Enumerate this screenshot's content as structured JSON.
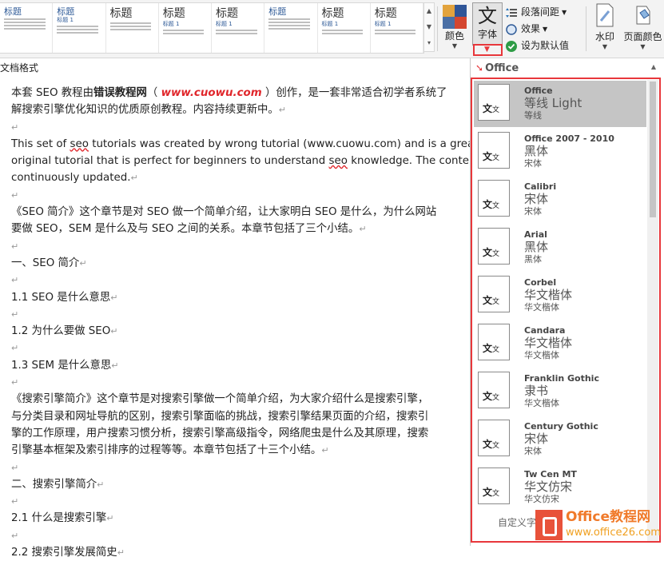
{
  "ribbon": {
    "styles_gallery": [
      {
        "heading": "标题",
        "sub": ""
      },
      {
        "heading": "标题",
        "sub": "标题 1"
      },
      {
        "heading": "标题",
        "sub": ""
      },
      {
        "heading": "标题",
        "sub": "标题 1"
      },
      {
        "heading": "标题",
        "sub": "标题 1"
      },
      {
        "heading": "标题",
        "sub": ""
      },
      {
        "heading": "标题",
        "sub": "标题 1"
      },
      {
        "heading": "标题",
        "sub": "标题 1"
      }
    ],
    "colors_label": "颜色",
    "fonts_label": "字体",
    "fonts_glyph": "文",
    "paragraph_spacing_label": "段落间距",
    "effects_label": "效果",
    "set_default_label": "设为默认值",
    "watermark_label": "水印",
    "page_color_label": "页面颜色",
    "swatch_colors": [
      "#e2a33d",
      "#2f5597",
      "#4a6fa5",
      "#d4462f"
    ]
  },
  "document_formatting_label": "文档格式",
  "document": {
    "p1_pre": "本套 SEO 教程由",
    "p1_bold": "错误教程网",
    "p1_url": "www.cuowu.com",
    "p1_post": "）创作，是一套非常适合初学者系统了",
    "p2": "解搜索引擎优化知识的优质原创教程。内容持续更新中。",
    "en1": "This set of seo tutorials was created by wrong tutorial (www.cuowu.com) and is a great",
    "en2": "original tutorial that is perfect for beginners to understand seo knowledge. The content is",
    "en3": "continuously updated.",
    "s1a": "《SEO 简介》这个章节是对 SEO 做一个简单介绍，让大家明白 SEO 是什么，为什么网站",
    "s1b": "要做 SEO，SEM 是什么及与 SEO 之间的关系。本章节包括了三个小结。",
    "h1": "一、SEO 简介",
    "h11": "1.1 SEO 是什么意思",
    "h12": "1.2  为什么要做 SEO",
    "h13": "1.3 SEM 是什么意思",
    "s2a": "《搜索引擎简介》这个章节是对搜索引擎做一个简单介绍，为大家介绍什么是搜索引擎，",
    "s2b": "与分类目录和网址导航的区别，搜索引擎面临的挑战，搜索引擎结果页面的介绍，搜索引",
    "s2c": "擎的工作原理，用户搜索习惯分析，搜索引擎高级指令，网络爬虫是什么及其原理，搜索",
    "s2d": "引擎基本框架及索引排序的过程等等。本章节包括了十三个小结。",
    "h2": "二、搜索引擎简介",
    "h21": "2.1 什么是搜索引擎",
    "h22": "2.2 搜索引擎发展简史"
  },
  "font_panel": {
    "header": "Office",
    "preview_glyph_big": "文",
    "preview_glyph_small": "文",
    "items": [
      {
        "name": "Office",
        "heading_font": "等线 Light",
        "body_font": "等线",
        "selected": true
      },
      {
        "name": "Office 2007 - 2010",
        "heading_font": "黑体",
        "body_font": "宋体",
        "selected": false
      },
      {
        "name": "Calibri",
        "heading_font": "宋体",
        "body_font": "宋体",
        "selected": false
      },
      {
        "name": "Arial",
        "heading_font": "黑体",
        "body_font": "黑体",
        "selected": false
      },
      {
        "name": "Corbel",
        "heading_font": "华文楷体",
        "body_font": "华文楷体",
        "selected": false
      },
      {
        "name": "Candara",
        "heading_font": "华文楷体",
        "body_font": "华文楷体",
        "selected": false
      },
      {
        "name": "Franklin Gothic",
        "heading_font": "隶书",
        "body_font": "华文楷体",
        "selected": false
      },
      {
        "name": "Century Gothic",
        "heading_font": "宋体",
        "body_font": "宋体",
        "selected": false
      },
      {
        "name": "Tw Cen MT",
        "heading_font": "华文仿宋",
        "body_font": "华文仿宋",
        "selected": false
      }
    ],
    "customize_label": "自定义字"
  },
  "watermark": {
    "line1": "Office教程网",
    "line2": "www.office26.com"
  }
}
